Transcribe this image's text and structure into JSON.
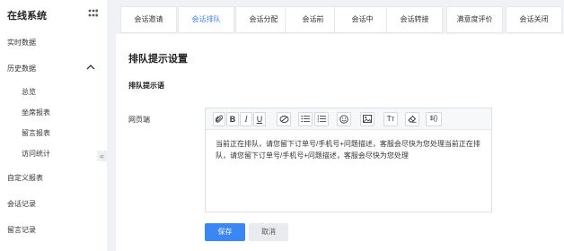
{
  "sidebar": {
    "title": "在线系统",
    "toggle_icon": "grid-toggle-icon",
    "items": [
      {
        "label": "实时数据"
      },
      {
        "label": "历史数据"
      },
      {
        "label": "自定义报表"
      },
      {
        "label": "会话记录"
      },
      {
        "label": "留言记录"
      }
    ],
    "history_children": [
      {
        "label": "总览"
      },
      {
        "label": "坐席报表"
      },
      {
        "label": "留言报表"
      },
      {
        "label": "访问统计"
      }
    ],
    "collapse_glyph": "«"
  },
  "tabs": [
    {
      "label": "会话邀请"
    },
    {
      "label": "会话排队"
    },
    {
      "label": "会话分配"
    },
    {
      "label": "会话前"
    },
    {
      "label": "会话中"
    },
    {
      "label": "会话转接"
    },
    {
      "label": "满意度评价"
    },
    {
      "label": "会话关闭"
    }
  ],
  "active_tab": "会话排队",
  "section_title": "排队提示设置",
  "sub_title": "排队提示语",
  "field_label": "网页端",
  "toolbar": {
    "bold": "B",
    "italic": "I",
    "underline": "U",
    "font_size": "Tт",
    "variable": "${}"
  },
  "editor_text": "当前正在排队，请您留下订单号/手机号+问题描述，客服会尽快为您处理当前正在排队，请您留下订单号/手机号+问题描述，客服会尽快为您处理",
  "buttons": {
    "save": "保存",
    "cancel": "取消"
  },
  "colors": {
    "accent": "#3a86f4",
    "background": "#f0f2f5"
  }
}
